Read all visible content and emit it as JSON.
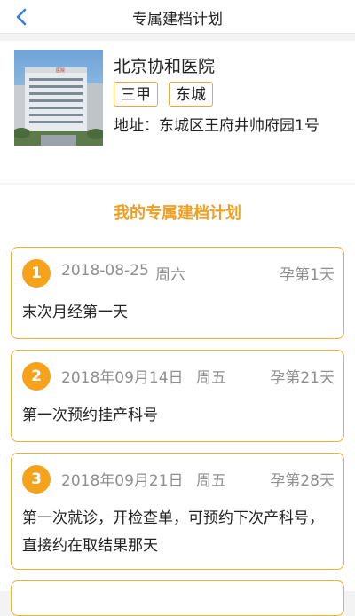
{
  "header": {
    "title": "专属建档计划",
    "back_icon": "chevron-left-icon",
    "accent_color": "#3a7fd5"
  },
  "hospital": {
    "name": "北京协和医院",
    "tags": [
      "三甲",
      "东城"
    ],
    "address": "地址：东城区王府井帅府园1号",
    "tag_border_color": "#f0a830"
  },
  "plan": {
    "heading": "我的专属建档计划",
    "heading_color": "#f0a020",
    "number_badge_color": "#f7a21b",
    "steps": [
      {
        "number": "1",
        "date": "2018-08-25",
        "weekday": "周六",
        "pregnancy_day": "孕第1天",
        "description": "末次月经第一天"
      },
      {
        "number": "2",
        "date": "2018年09月14日",
        "weekday": "周五",
        "pregnancy_day": "孕第21天",
        "description": "第一次预约挂产科号"
      },
      {
        "number": "3",
        "date": "2018年09月21日",
        "weekday": "周五",
        "pregnancy_day": "孕第28天",
        "description": "第一次就诊，开检查单，可预约下次产科号，直接约在取结果那天"
      }
    ]
  }
}
